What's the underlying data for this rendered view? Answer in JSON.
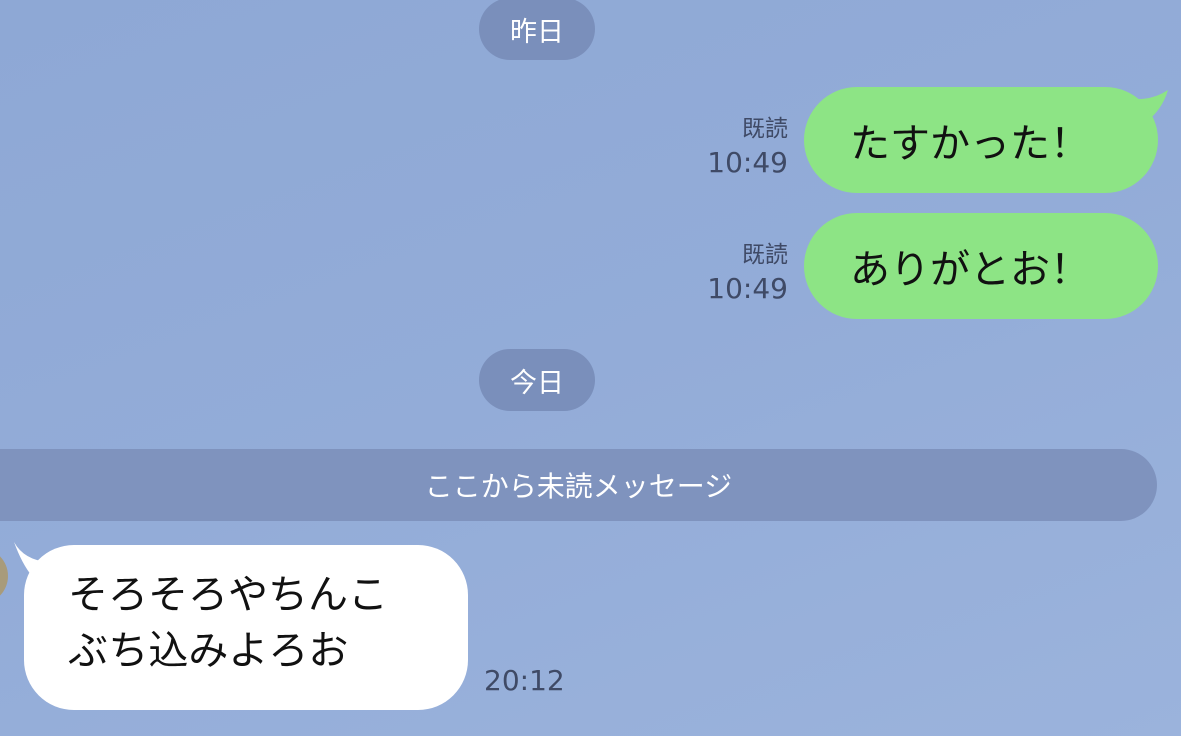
{
  "chat": {
    "date_yesterday": "昨日",
    "date_today": "今日",
    "unread_banner": "ここから未読メッセージ",
    "messages": [
      {
        "direction": "outgoing",
        "text": "たすかった！",
        "read_label": "既読",
        "time": "10:49"
      },
      {
        "direction": "outgoing",
        "text": "ありがとお！",
        "read_label": "既読",
        "time": "10:49"
      },
      {
        "direction": "incoming",
        "lines": [
          "そろそろやちんこ",
          "ぶち込みよろお"
        ],
        "time": "20:12"
      }
    ]
  },
  "colors": {
    "background": "#8fa9d6",
    "outgoing_bubble": "#8de485",
    "incoming_bubble": "#ffffff",
    "date_pill": "#7a8fbb",
    "unread_banner": "#7f93be"
  }
}
